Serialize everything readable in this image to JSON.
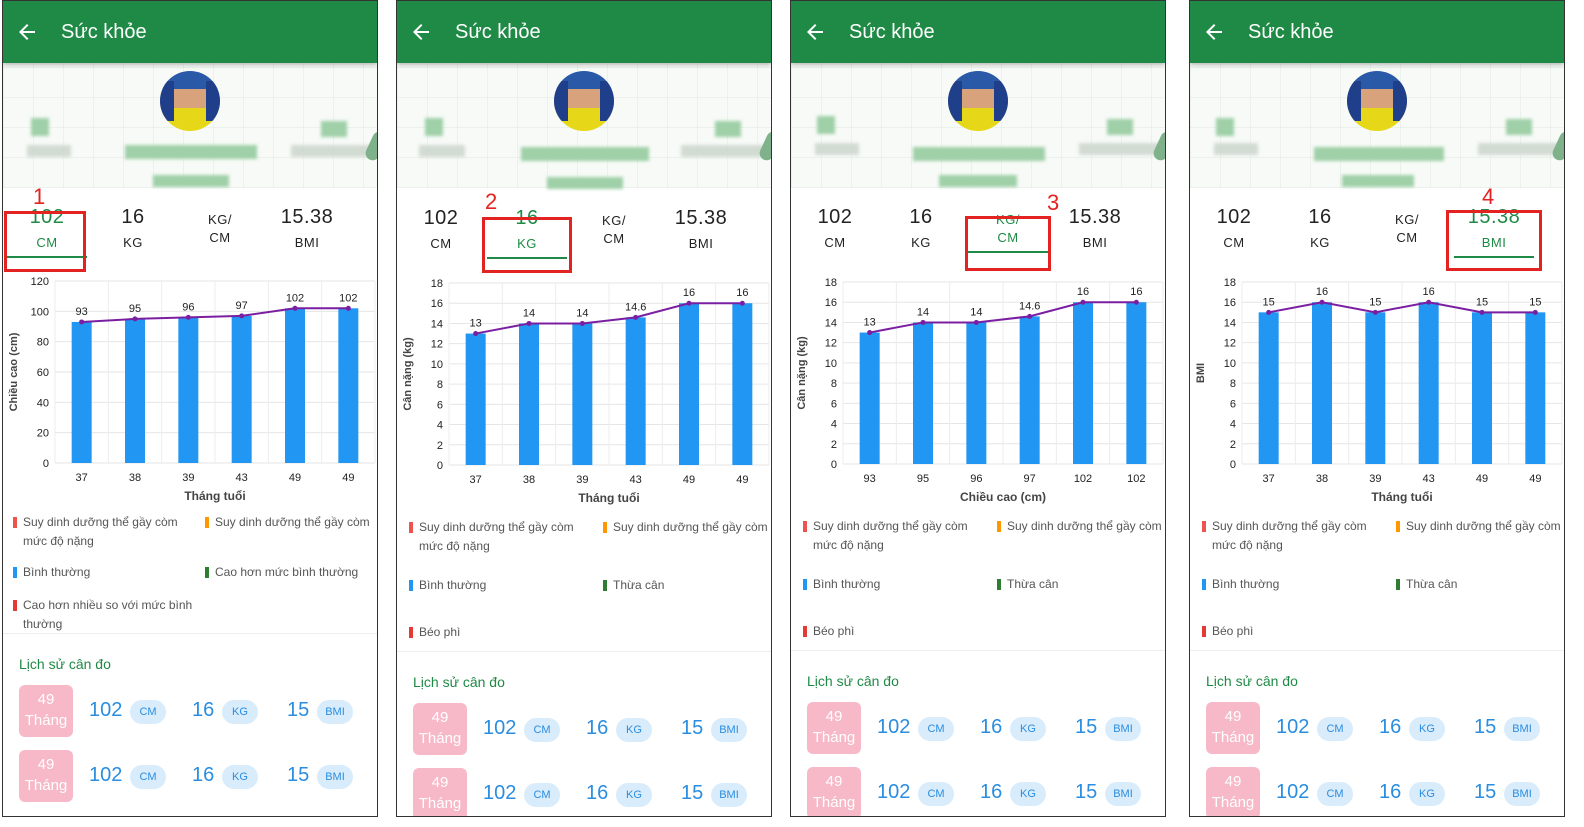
{
  "app": {
    "title": "Sức khỏe"
  },
  "units": {
    "cm": "CM",
    "kg": "KG",
    "kgcm_top": "KG/",
    "kgcm_bottom": "CM",
    "bmi": "BMI"
  },
  "stats": {
    "height": "102",
    "weight": "16",
    "bmi": "15.38"
  },
  "markers": [
    "1",
    "2",
    "3",
    "4"
  ],
  "colors": {
    "appbar": "#1e8a45",
    "accent_green": "#1e8a45",
    "highlight_red": "#e32222",
    "bar": "#2196f3",
    "line": "#7b1fa2",
    "age_badge": "#f7b9c8",
    "pill_bg": "#d9ecfb",
    "pill_text": "#2a8de0"
  },
  "legend": {
    "severe": "Suy dinh dưỡng thể gầy còm mức độ nặng",
    "wasting": "Suy dinh dưỡng thể gầy còm",
    "normal": "Bình thường",
    "above": "Cao hơn mức bình thường",
    "much_above": "Cao hơn nhiều so với mức bình thường",
    "overweight": "Thừa cân",
    "obese": "Béo phì",
    "colors": {
      "severe": "#ef5350",
      "wasting": "#ff9800",
      "normal": "#2196f3",
      "green": "#2e7d32",
      "red": "#e53935"
    }
  },
  "history": {
    "title": "Lịch sử cân đo",
    "rows": [
      {
        "age": "49",
        "age_unit": "Tháng",
        "height": "102",
        "weight": "16",
        "bmi": "15"
      },
      {
        "age": "49",
        "age_unit": "Tháng",
        "height": "102",
        "weight": "16",
        "bmi": "15"
      }
    ]
  },
  "chart_data": [
    {
      "type": "bar",
      "categories": [
        "37",
        "38",
        "39",
        "43",
        "49",
        "49"
      ],
      "values": [
        93,
        95,
        96,
        97,
        102,
        102
      ],
      "line": [
        93,
        95,
        96,
        97,
        102,
        102
      ],
      "xlabel": "Tháng tuổi",
      "ylabel": "Chiều cao (cm)",
      "ylim": [
        0,
        120
      ],
      "ticks": [
        0,
        20,
        40,
        60,
        80,
        100,
        120
      ],
      "grid": true
    },
    {
      "type": "bar",
      "categories": [
        "37",
        "38",
        "39",
        "43",
        "49",
        "49"
      ],
      "values": [
        13,
        14,
        14,
        14.6,
        16,
        16
      ],
      "line": [
        13,
        14,
        14,
        14.6,
        16,
        16
      ],
      "labels": [
        "13",
        "14",
        "14",
        "14.6",
        "16",
        "16"
      ],
      "xlabel": "Tháng tuổi",
      "ylabel": "Cân nặng (kg)",
      "ylim": [
        0,
        18
      ],
      "ticks": [
        0,
        2,
        4,
        6,
        8,
        10,
        12,
        14,
        16,
        18
      ],
      "grid": true
    },
    {
      "type": "bar",
      "categories": [
        "93",
        "95",
        "96",
        "97",
        "102",
        "102"
      ],
      "values": [
        13,
        14,
        14,
        14.6,
        16,
        16
      ],
      "line": [
        13,
        14,
        14,
        14.6,
        16,
        16
      ],
      "labels": [
        "13",
        "14",
        "14",
        "14.6",
        "16",
        "16"
      ],
      "xlabel": "Chiều cao (cm)",
      "ylabel": "Cân nặng (kg)",
      "ylim": [
        0,
        18
      ],
      "ticks": [
        0,
        2,
        4,
        6,
        8,
        10,
        12,
        14,
        16,
        18
      ],
      "grid": true
    },
    {
      "type": "bar",
      "categories": [
        "37",
        "38",
        "39",
        "43",
        "49",
        "49"
      ],
      "values": [
        15,
        16,
        15,
        16,
        15,
        15
      ],
      "line": [
        15,
        16,
        15,
        16,
        15,
        15
      ],
      "xlabel": "Tháng tuổi",
      "ylabel": "BMI",
      "ylim": [
        0,
        18
      ],
      "ticks": [
        0,
        2,
        4,
        6,
        8,
        10,
        12,
        14,
        16,
        18
      ],
      "grid": true
    }
  ]
}
